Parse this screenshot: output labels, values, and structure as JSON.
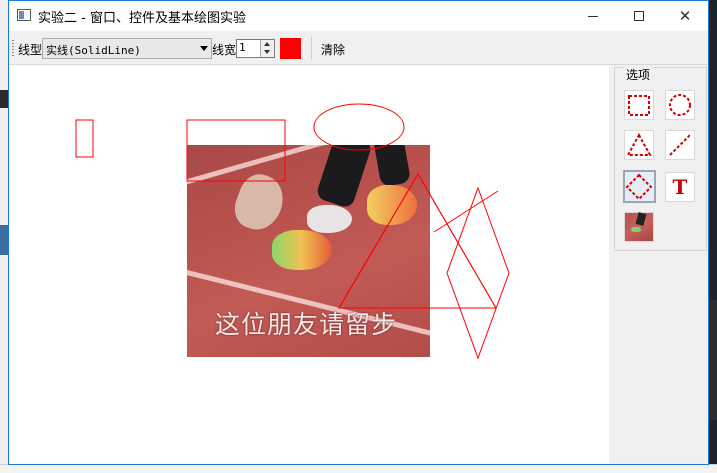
{
  "window": {
    "title": "实验二 - 窗口、控件及基本绘图实验",
    "minimize_glyph": "minimize",
    "maximize_glyph": "maximize",
    "close_glyph": "✕"
  },
  "toolbar": {
    "line_type_label": "线型",
    "line_type_value": "实线(SolidLine)",
    "line_width_label": "线宽",
    "line_width_value": "1",
    "pen_color": "#ff0000",
    "clear_label": "清除"
  },
  "canvas": {
    "stroke_color": "#ff0000",
    "photo_caption": "这位朋友请留步"
  },
  "tools_panel": {
    "title": "选项",
    "tools": [
      {
        "name": "rectangle",
        "icon": "dashed-rectangle-icon",
        "selected": false
      },
      {
        "name": "ellipse",
        "icon": "dashed-circle-icon",
        "selected": false
      },
      {
        "name": "triangle",
        "icon": "dashed-triangle-icon",
        "selected": false
      },
      {
        "name": "line",
        "icon": "dashed-line-icon",
        "selected": false
      },
      {
        "name": "diamond",
        "icon": "dashed-diamond-icon",
        "selected": true
      },
      {
        "name": "text",
        "icon": "text-T-icon",
        "label": "T",
        "selected": false
      },
      {
        "name": "image",
        "icon": "image-thumbnail-icon",
        "selected": false
      }
    ]
  }
}
